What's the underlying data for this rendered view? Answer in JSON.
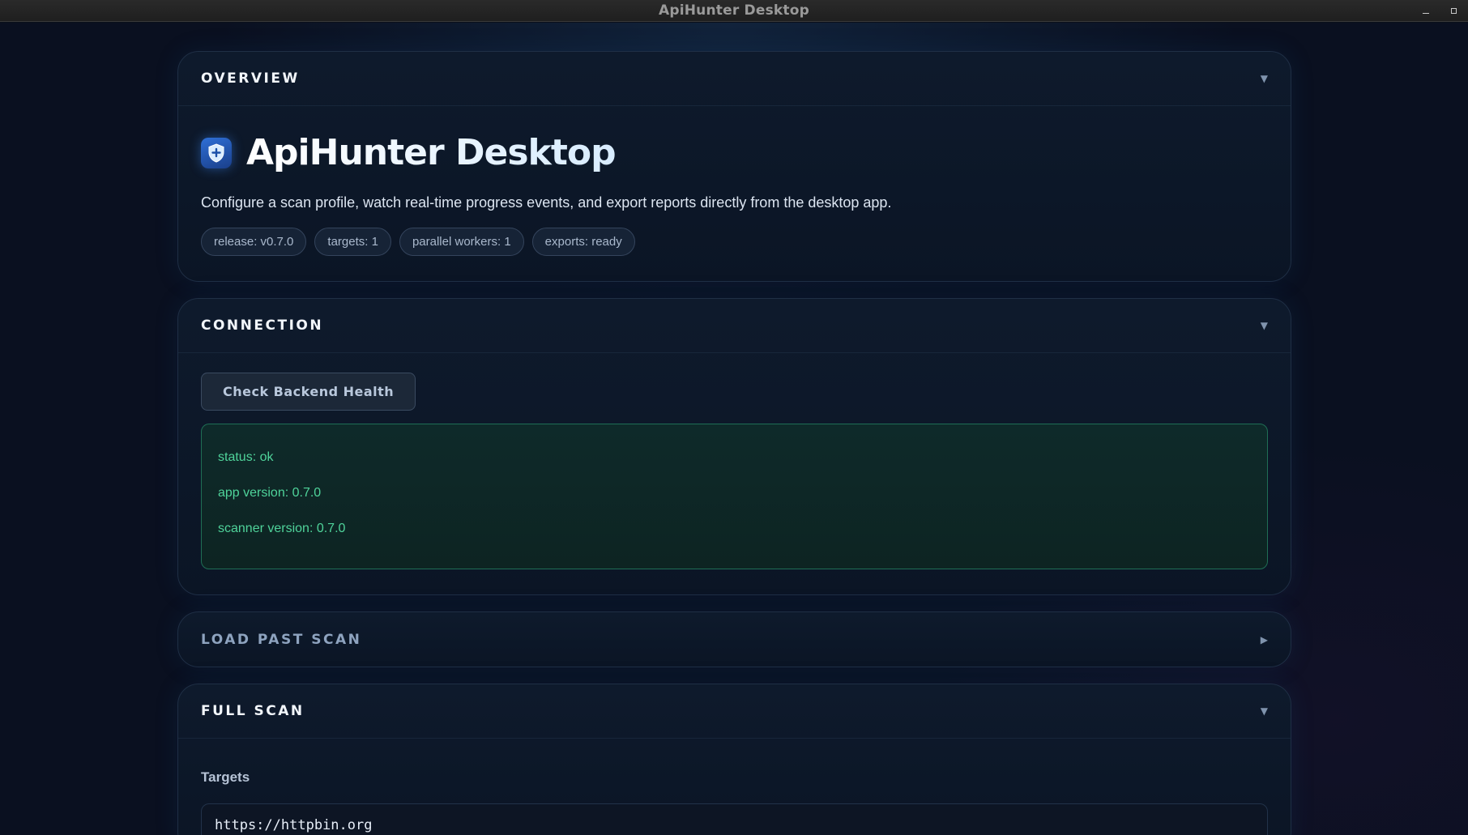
{
  "window": {
    "title": "ApiHunter Desktop"
  },
  "overview": {
    "section_title": "OVERVIEW",
    "app_title": "ApiHunter Desktop",
    "description": "Configure a scan profile, watch real-time progress events, and export reports directly from the desktop app.",
    "pills": [
      "release: v0.7.0",
      "targets: 1",
      "parallel workers: 1",
      "exports: ready"
    ]
  },
  "connection": {
    "section_title": "CONNECTION",
    "health_button_label": "Check Backend Health",
    "health": {
      "status": "status: ok",
      "app_version": "app version: 0.7.0",
      "scanner_version": "scanner version: 0.7.0"
    }
  },
  "load_past_scan": {
    "section_title": "LOAD PAST SCAN",
    "expanded": false
  },
  "full_scan": {
    "section_title": "FULL SCAN",
    "targets_label": "Targets",
    "targets_value": "https://httpbin.org"
  },
  "icons": {
    "expanded_chevron": "▼",
    "collapsed_chevron": "▶",
    "app_icon": "shield-icon"
  },
  "colors": {
    "accent": "#2f6fd6",
    "success": "#4fd39a",
    "background": "#0a1020"
  }
}
